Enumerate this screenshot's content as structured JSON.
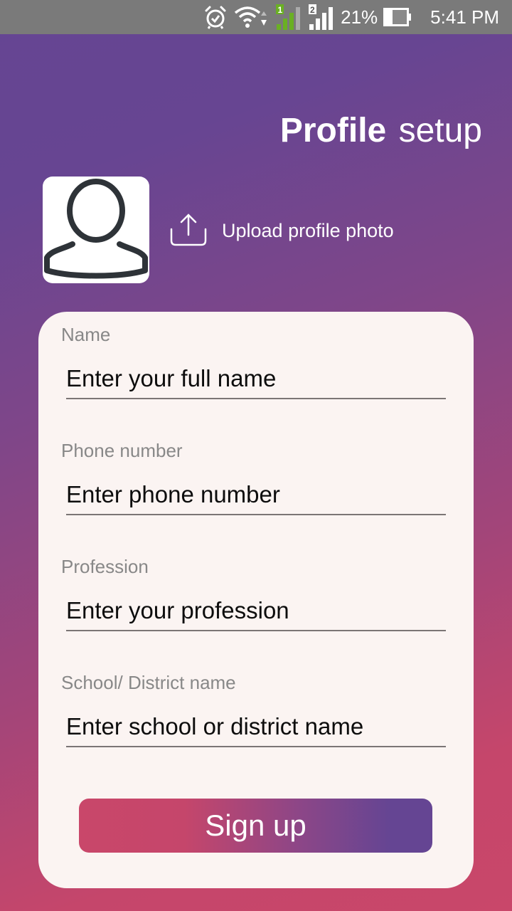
{
  "status_bar": {
    "icons": [
      "alarm-icon",
      "wifi-icon",
      "sim1-signal-icon",
      "sim2-signal-icon",
      "battery-icon"
    ],
    "sim1_label": "1",
    "sim2_label": "2",
    "battery_percent": "21%",
    "time": "5:41 PM",
    "colors": {
      "background": "#7a7a7a",
      "sim1_active": "#6ab023"
    }
  },
  "header": {
    "title_bold": "Profile",
    "title_light": "setup"
  },
  "profile_photo": {
    "avatar_icon": "user-placeholder-icon",
    "upload_icon": "upload-icon",
    "upload_label": "Upload profile photo"
  },
  "form": {
    "fields": [
      {
        "label": "Name",
        "placeholder": "Enter your full name",
        "value": ""
      },
      {
        "label": "Phone number",
        "placeholder": "Enter phone number",
        "value": ""
      },
      {
        "label": "Profession",
        "placeholder": "Enter your profession",
        "value": ""
      },
      {
        "label": "School/ District name",
        "placeholder": "Enter school or district name",
        "value": ""
      }
    ],
    "submit_label": "Sign up"
  },
  "theme": {
    "gradient_purple": "#654593",
    "gradient_pink": "#c9476a",
    "card_background": "#fbf4f2",
    "label_color": "#888888"
  }
}
